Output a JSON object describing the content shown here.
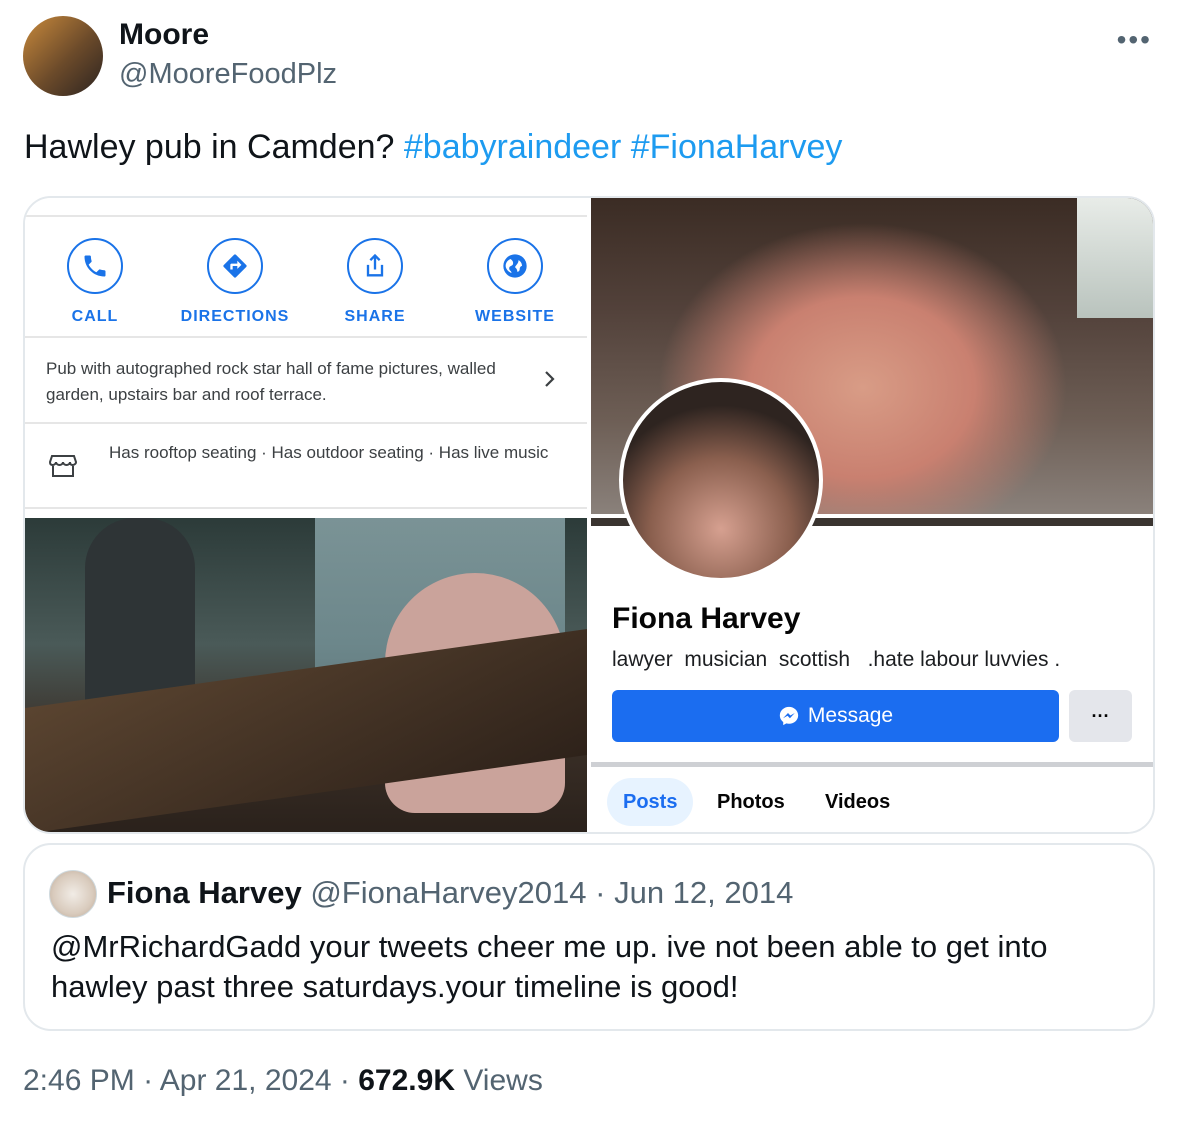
{
  "author": {
    "display_name": "Moore",
    "handle": "@MooreFoodPlz"
  },
  "tweet": {
    "text": "Hawley pub in Camden? ",
    "hashtags": [
      "#babyraindeer",
      "#FionaHarvey"
    ]
  },
  "maps_card": {
    "actions": [
      "CALL",
      "DIRECTIONS",
      "SHARE",
      "WEBSITE"
    ],
    "description": "Pub with autographed rock star hall of fame pictures, walled garden, upstairs bar and roof terrace.",
    "amenities": "Has rooftop seating · Has outdoor seating · Has live music"
  },
  "fb_card": {
    "name": "Fiona Harvey",
    "bio": "lawyer  musician  scottish   .hate labour luvvies .",
    "message_label": "Message",
    "more_label": "···",
    "tabs": [
      "Posts",
      "Photos",
      "Videos"
    ],
    "active_tab": "Posts"
  },
  "quote": {
    "name": "Fiona Harvey",
    "handle": "@FionaHarvey2014",
    "separator": "·",
    "date": "Jun 12, 2014",
    "text": "@MrRichardGadd your tweets cheer me up. ive not been able to get into hawley past three saturdays.your timeline is good!"
  },
  "footer": {
    "time": "2:46 PM",
    "separator": "·",
    "date": "Apr 21, 2024",
    "views_count": "672.9K",
    "views_label": "Views"
  },
  "colors": {
    "link": "#1d9bf0",
    "maps_blue": "#1a73e8",
    "fb_blue": "#1b6df0",
    "muted": "#536471"
  }
}
